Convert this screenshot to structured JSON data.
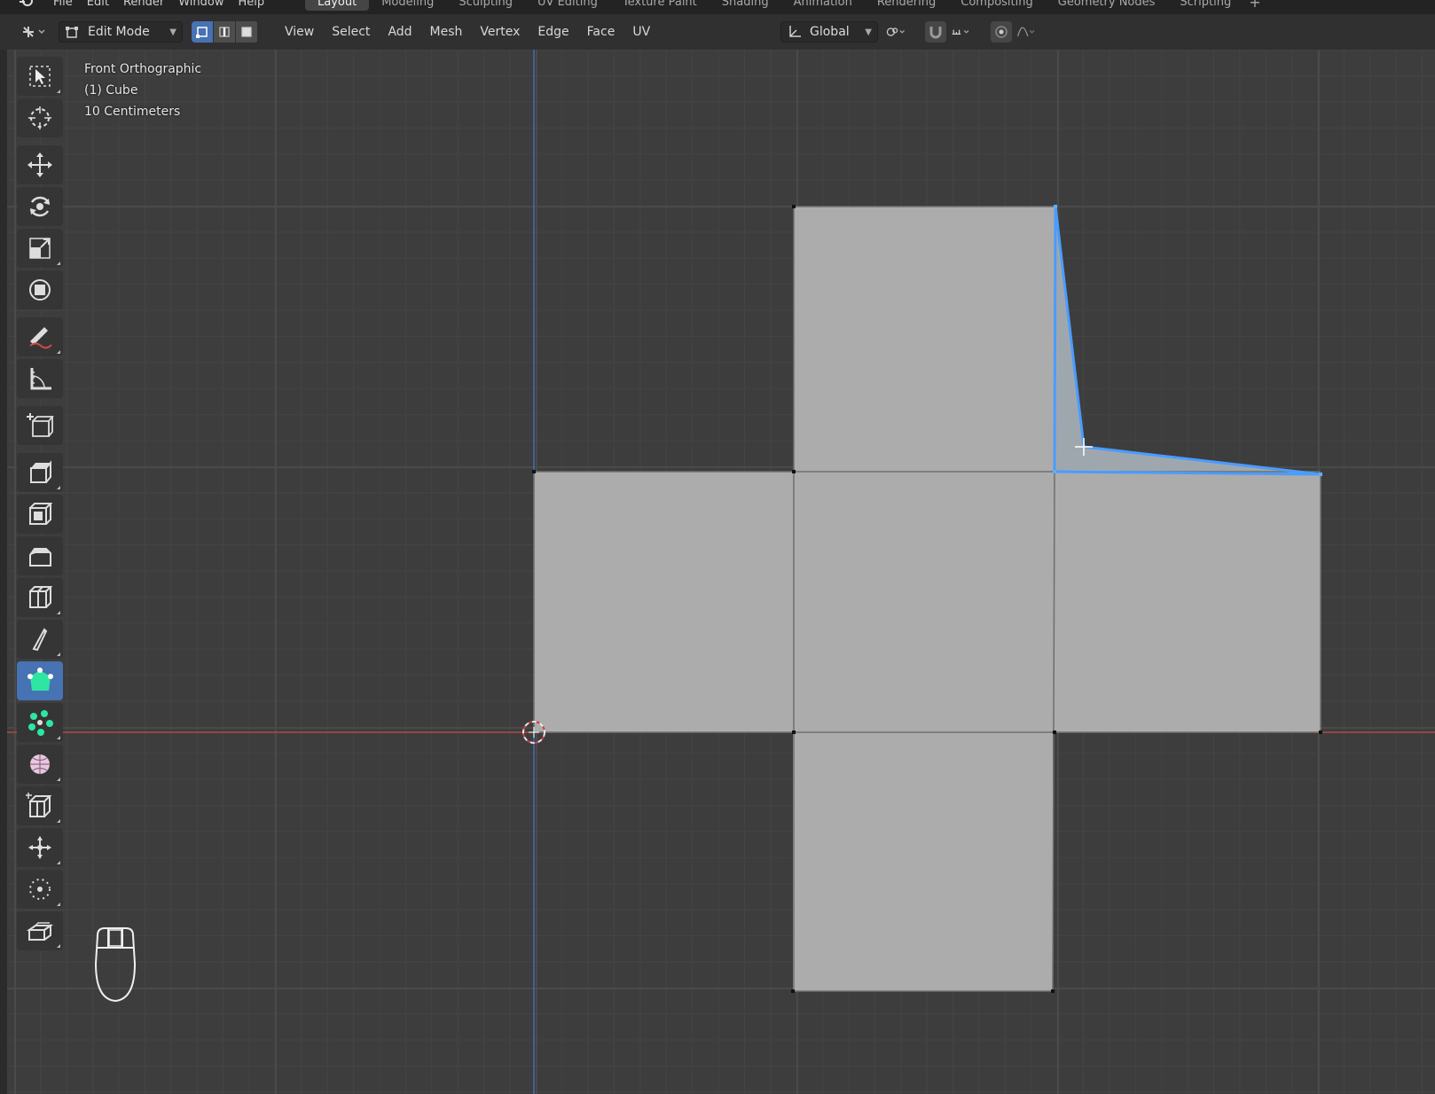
{
  "topbar": {
    "menus": [
      "File",
      "Edit",
      "Render",
      "Window",
      "Help"
    ],
    "workspaces": [
      "Layout",
      "Modeling",
      "Sculpting",
      "UV Editing",
      "Texture Paint",
      "Shading",
      "Animation",
      "Rendering",
      "Compositing",
      "Geometry Nodes",
      "Scripting"
    ],
    "active_workspace": "Layout",
    "add_label": "+"
  },
  "header": {
    "mode": "Edit Mode",
    "menus": [
      "View",
      "Select",
      "Add",
      "Mesh",
      "Vertex",
      "Edge",
      "Face",
      "UV"
    ],
    "orientation": "Global",
    "select_mode_active": "vertex"
  },
  "overlay": {
    "view_name": "Front Orthographic",
    "object_name": "(1) Cube",
    "scale": "10 Centimeters"
  },
  "toolbar": {
    "tools": [
      "select-box-tool",
      "cursor-tool",
      "move-tool",
      "rotate-tool",
      "scale-tool",
      "transform-tool",
      "annotate-tool",
      "measure-tool",
      "add-cube-tool",
      "extrude-region-tool",
      "inset-faces-tool",
      "bevel-tool",
      "loop-cut-tool",
      "knife-tool",
      "poly-build-tool",
      "spin-tool",
      "smooth-tool",
      "edge-slide-tool",
      "shrink-fatten-tool",
      "shear-tool",
      "rip-region-tool"
    ],
    "active_tool": "poly-build-tool"
  },
  "colors": {
    "viewport_bg": "#3d3d3d",
    "face": "#acacac",
    "selected_edge": "#4a9cff",
    "x_axis": "#b34646",
    "z_axis": "#3f6fb8",
    "active_tool": "#4772b3"
  }
}
